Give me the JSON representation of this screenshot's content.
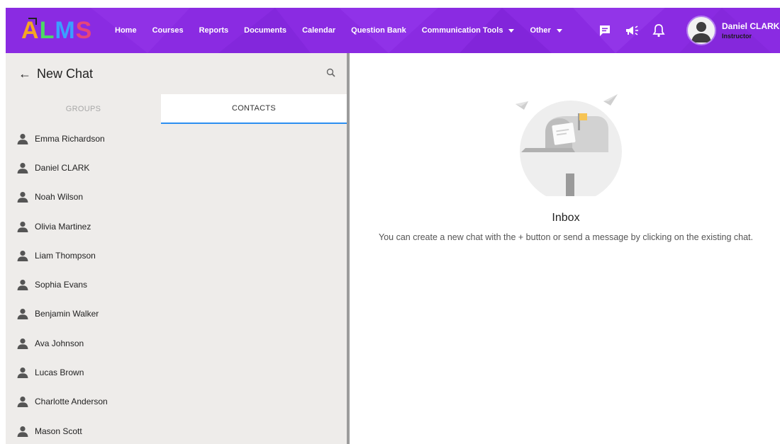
{
  "brand": {
    "logo_letters": [
      "A",
      "L",
      "M",
      "S"
    ],
    "logo_colors": [
      "#f5a623",
      "#4cd964",
      "#3aa0ff",
      "#e6457a"
    ],
    "nav_color": "#8a2be2"
  },
  "menu": {
    "items": [
      "Home",
      "Courses",
      "Reports",
      "Documents",
      "Calendar",
      "Question Bank"
    ],
    "communication": "Communication Tools",
    "other": "Other"
  },
  "nav_icons": [
    "chat-icon",
    "megaphone-icon",
    "bell-icon"
  ],
  "user": {
    "name": "Daniel CLARK",
    "role": "Instructor"
  },
  "panel": {
    "title": "New Chat",
    "tabs": {
      "groups": "GROUPS",
      "contacts": "CONTACTS"
    },
    "active_tab": "contacts",
    "accent": "#2b8ef0"
  },
  "contacts": [
    "Emma Richardson",
    "Daniel CLARK",
    "Noah Wilson",
    "Olivia Martinez",
    "Liam Thompson",
    "Sophia Evans",
    "Benjamin Walker",
    "Ava Johnson",
    "Lucas Brown",
    "Charlotte Anderson",
    "Mason Scott"
  ],
  "inbox": {
    "title": "Inbox",
    "description": "You can create a new chat with the + button or send a message by clicking on the existing chat."
  }
}
